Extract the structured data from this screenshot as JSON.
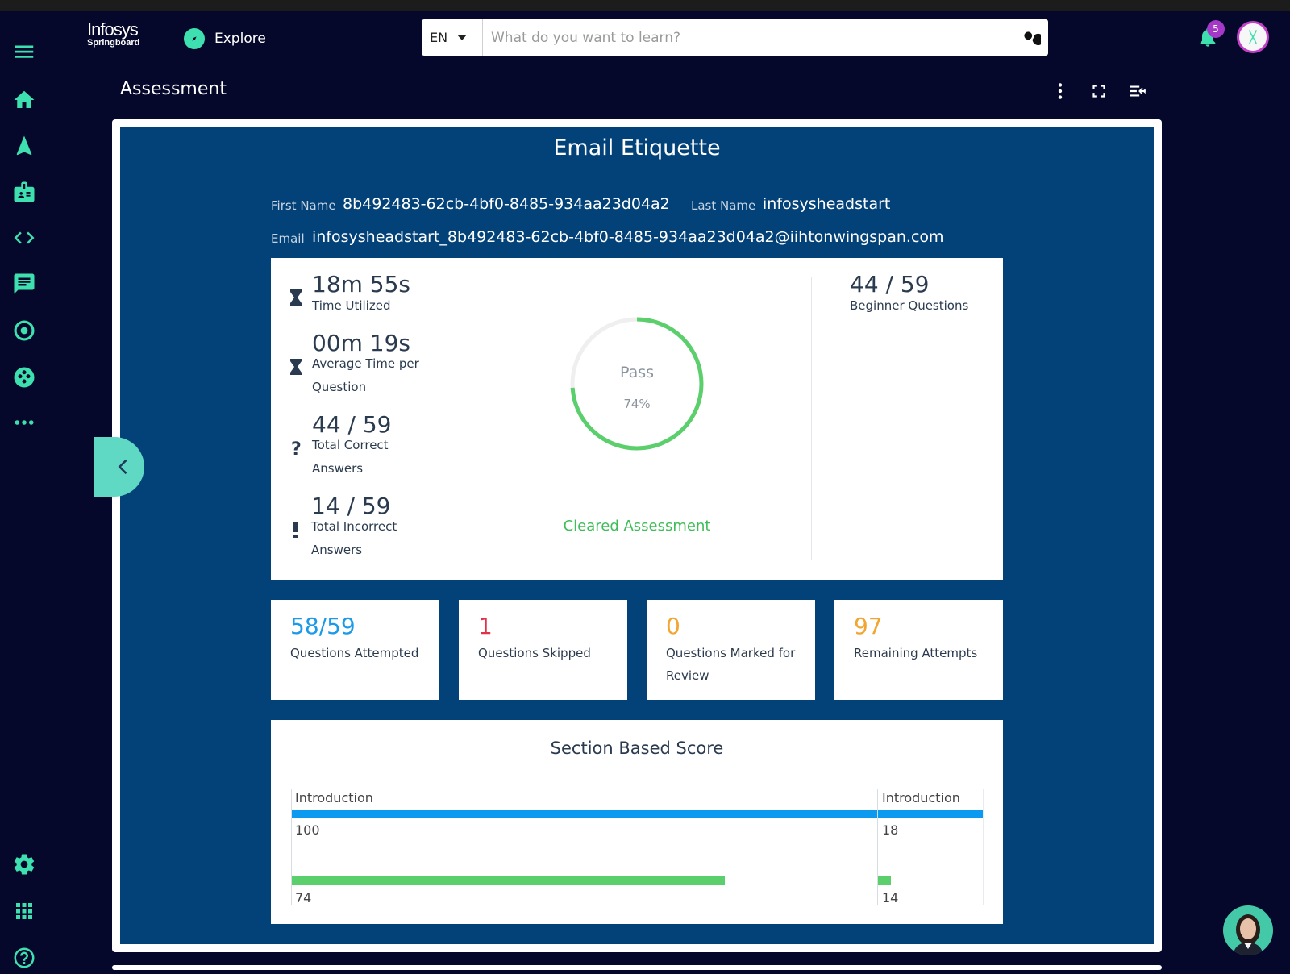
{
  "header": {
    "logo": {
      "line1": "Infosys",
      "line2": "Springboard"
    },
    "explore_label": "Explore",
    "language": "EN",
    "search_placeholder": "What do you want to learn?",
    "notification_count": "5",
    "page_title": "Assessment"
  },
  "sidebar": {
    "items": [
      "home-icon",
      "navigation-icon",
      "badge-icon",
      "code-icon",
      "chat-icon",
      "target-icon",
      "community-icon",
      "more-icon",
      "settings-icon",
      "apps-grid-icon",
      "help-icon"
    ]
  },
  "assessment": {
    "title": "Email Etiquette",
    "first_name_label": "First Name",
    "first_name": "8b492483-62cb-4bf0-8485-934aa23d04a2",
    "last_name_label": "Last Name",
    "last_name": "infosysheadstart",
    "email_label": "Email",
    "email": "infosysheadstart_8b492483-62cb-4bf0-8485-934aa23d04a2@iihtonwingspan.com"
  },
  "summary": {
    "time_utilized": {
      "value": "18m 55s",
      "label": "Time Utilized"
    },
    "avg_time": {
      "value": "00m 19s",
      "label_line1": "Average Time per",
      "label_line2": "Question"
    },
    "total_correct": {
      "value": "44 / 59",
      "label_line1": "Total Correct",
      "label_line2": "Answers"
    },
    "total_incorrect": {
      "value": "14 / 59",
      "label_line1": "Total Incorrect",
      "label_line2": "Answers"
    },
    "result": {
      "status": "Pass",
      "percent_text": "74%",
      "percent": 74,
      "message": "Cleared Assessment"
    },
    "beginner": {
      "value": "44 / 59",
      "label": "Beginner Questions"
    }
  },
  "stats": [
    {
      "value": "58/59",
      "label_line1": "Questions Attempted",
      "label_line2": "",
      "color": "#1a9ae8"
    },
    {
      "value": "1",
      "label_line1": "Questions Skipped",
      "label_line2": "",
      "color": "#e0304a"
    },
    {
      "value": "0",
      "label_line1": "Questions Marked for",
      "label_line2": "Review",
      "color": "#f2a632"
    },
    {
      "value": "97",
      "label_line1": "Remaining Attempts",
      "label_line2": "",
      "color": "#f2a632"
    }
  ],
  "section_score": {
    "title": "Section Based Score",
    "left": {
      "label": "Introduction",
      "top_value": "100",
      "bottom_value": "74",
      "bottom_fraction": 0.74
    },
    "right": {
      "label": "Introduction",
      "top_value": "18",
      "bottom_value": "14",
      "bottom_fraction": 0.12
    }
  },
  "colors": {
    "background": "#05082a",
    "accent": "#3fe0b0",
    "panel": "#034278",
    "bar_blue": "#0b9af0",
    "bar_green": "#5bcf6b",
    "pass_green": "#3fbd57"
  }
}
